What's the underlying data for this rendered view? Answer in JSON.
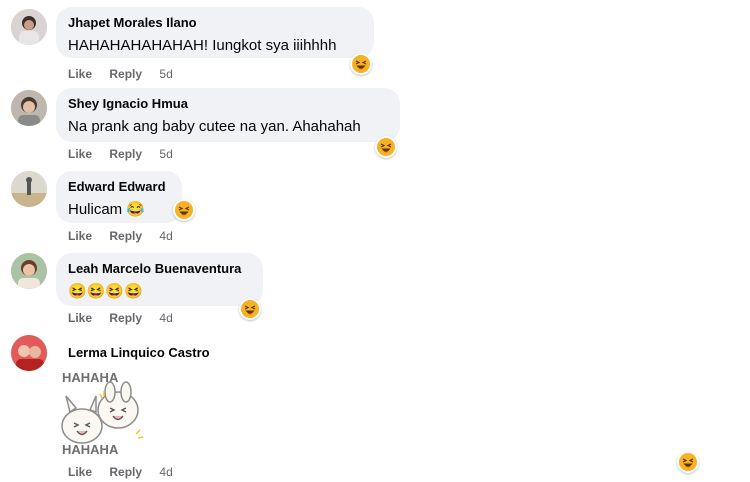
{
  "comments": [
    {
      "author": "Jhapet Morales Ilano",
      "text": "HAHAHAHAHAHAH! Iungkot sya iiihhhh",
      "like": "Like",
      "reply": "Reply",
      "time": "5d",
      "reaction": "haha-icon"
    },
    {
      "author": "Shey Ignacio Hmua",
      "text": "Na prank ang baby cutee na yan. Ahahahah",
      "like": "Like",
      "reply": "Reply",
      "time": "5d",
      "reaction": "haha-icon"
    },
    {
      "author": "Edward Edward",
      "text": "Hulicam 😂",
      "like": "Like",
      "reply": "Reply",
      "time": "4d",
      "reaction": "haha-icon"
    },
    {
      "author": "Leah Marcelo Buenaventura",
      "text": "😆😆😆😆",
      "like": "Like",
      "reply": "Reply",
      "time": "4d",
      "reaction": "haha-icon"
    },
    {
      "author": "Lerma Linquico Castro",
      "sticker_text_top": "HAHAHA",
      "sticker_text_bottom": "HAHAHA",
      "like": "Like",
      "reply": "Reply",
      "time": "4d",
      "reaction": "haha-icon"
    }
  ],
  "colors": {
    "bubble": "#f0f2f5",
    "meta": "#65676b",
    "haha": "#f7b125"
  }
}
